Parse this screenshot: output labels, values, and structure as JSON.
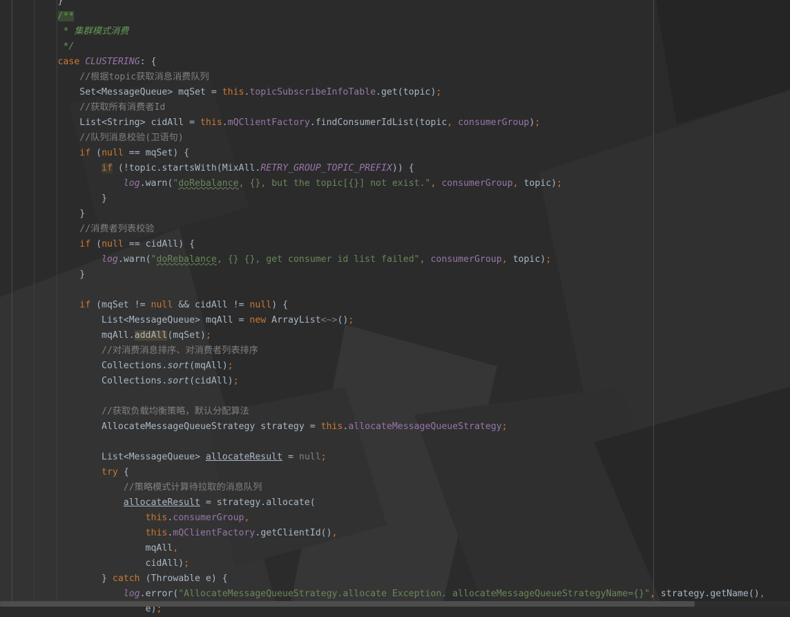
{
  "editor": {
    "lines": [
      [
        {
          "t": "        ",
          "c": "plain"
        },
        {
          "t": "}",
          "c": "plain"
        }
      ],
      [
        {
          "t": "        ",
          "c": "plain"
        },
        {
          "t": "/**",
          "c": "doc-hl"
        }
      ],
      [
        {
          "t": "         * 集群模式消费",
          "c": "doc"
        }
      ],
      [
        {
          "t": "         */",
          "c": "doc"
        }
      ],
      [
        {
          "t": "        ",
          "c": "plain"
        },
        {
          "t": "case ",
          "c": "kw"
        },
        {
          "t": "CLUSTERING",
          "c": "const"
        },
        {
          "t": ": {",
          "c": "plain"
        }
      ],
      [
        {
          "t": "            ",
          "c": "plain"
        },
        {
          "t": "//根据topic获取消息消费队列",
          "c": "comment"
        }
      ],
      [
        {
          "t": "            Set<MessageQueue> mqSet = ",
          "c": "plain"
        },
        {
          "t": "this",
          "c": "kw"
        },
        {
          "t": ".",
          "c": "plain"
        },
        {
          "t": "topicSubscribeInfoTable",
          "c": "field"
        },
        {
          "t": ".get(topic)",
          "c": "plain"
        },
        {
          "t": ";",
          "c": "punct"
        }
      ],
      [
        {
          "t": "            ",
          "c": "plain"
        },
        {
          "t": "//获取所有消费者Id",
          "c": "comment"
        }
      ],
      [
        {
          "t": "            List<String> cidAll = ",
          "c": "plain"
        },
        {
          "t": "this",
          "c": "kw"
        },
        {
          "t": ".",
          "c": "plain"
        },
        {
          "t": "mQClientFactory",
          "c": "field"
        },
        {
          "t": ".findConsumerIdList(topic",
          "c": "plain"
        },
        {
          "t": ", ",
          "c": "punct"
        },
        {
          "t": "consumerGroup",
          "c": "field"
        },
        {
          "t": ")",
          "c": "plain"
        },
        {
          "t": ";",
          "c": "punct"
        }
      ],
      [
        {
          "t": "            ",
          "c": "plain"
        },
        {
          "t": "//队列消息校验(卫语句)",
          "c": "comment"
        }
      ],
      [
        {
          "t": "            ",
          "c": "plain"
        },
        {
          "t": "if ",
          "c": "kw"
        },
        {
          "t": "(",
          "c": "plain"
        },
        {
          "t": "null ",
          "c": "kw"
        },
        {
          "t": "== mqSet) {",
          "c": "plain"
        }
      ],
      [
        {
          "t": "                ",
          "c": "plain"
        },
        {
          "t": "if",
          "c": "kw-hl"
        },
        {
          "t": " (!topic.startsWith(MixAll.",
          "c": "plain"
        },
        {
          "t": "RETRY_GROUP_TOPIC_PREFIX",
          "c": "const"
        },
        {
          "t": ")) {",
          "c": "plain"
        }
      ],
      [
        {
          "t": "                    ",
          "c": "plain"
        },
        {
          "t": "log",
          "c": "log"
        },
        {
          "t": ".warn(",
          "c": "plain"
        },
        {
          "t": "\"",
          "c": "string"
        },
        {
          "t": "doRebalance",
          "c": "string-typo"
        },
        {
          "t": ", {}, but the topic[{}] not exist.\"",
          "c": "string"
        },
        {
          "t": ", ",
          "c": "punct"
        },
        {
          "t": "consumerGroup",
          "c": "field"
        },
        {
          "t": ", ",
          "c": "punct"
        },
        {
          "t": "topic)",
          "c": "plain"
        },
        {
          "t": ";",
          "c": "punct"
        }
      ],
      [
        {
          "t": "                }",
          "c": "plain"
        }
      ],
      [
        {
          "t": "            }",
          "c": "plain"
        }
      ],
      [
        {
          "t": "            ",
          "c": "plain"
        },
        {
          "t": "//消费者列表校验",
          "c": "comment"
        }
      ],
      [
        {
          "t": "            ",
          "c": "plain"
        },
        {
          "t": "if ",
          "c": "kw"
        },
        {
          "t": "(",
          "c": "plain"
        },
        {
          "t": "null ",
          "c": "kw"
        },
        {
          "t": "== cidAll) {",
          "c": "plain"
        }
      ],
      [
        {
          "t": "                ",
          "c": "plain"
        },
        {
          "t": "log",
          "c": "log"
        },
        {
          "t": ".warn(",
          "c": "plain"
        },
        {
          "t": "\"",
          "c": "string"
        },
        {
          "t": "doRebalance",
          "c": "string-typo"
        },
        {
          "t": ", {} {}, get consumer id list failed\"",
          "c": "string"
        },
        {
          "t": ", ",
          "c": "punct"
        },
        {
          "t": "consumerGroup",
          "c": "field"
        },
        {
          "t": ", ",
          "c": "punct"
        },
        {
          "t": "topic)",
          "c": "plain"
        },
        {
          "t": ";",
          "c": "punct"
        }
      ],
      [
        {
          "t": "            }",
          "c": "plain"
        }
      ],
      [
        {
          "t": "",
          "c": "plain"
        }
      ],
      [
        {
          "t": "            ",
          "c": "plain"
        },
        {
          "t": "if ",
          "c": "kw"
        },
        {
          "t": "(mqSet != ",
          "c": "plain"
        },
        {
          "t": "null ",
          "c": "kw"
        },
        {
          "t": "&& cidAll != ",
          "c": "plain"
        },
        {
          "t": "null",
          "c": "kw"
        },
        {
          "t": ") {",
          "c": "plain"
        }
      ],
      [
        {
          "t": "                List<MessageQueue> mqAll = ",
          "c": "plain"
        },
        {
          "t": "new ",
          "c": "kw"
        },
        {
          "t": "ArrayList",
          "c": "plain"
        },
        {
          "t": "<~>",
          "c": "fold"
        },
        {
          "t": "()",
          "c": "plain"
        },
        {
          "t": ";",
          "c": "punct"
        }
      ],
      [
        {
          "t": "                mqAll.",
          "c": "plain"
        },
        {
          "t": "addAll",
          "c": "call-hl"
        },
        {
          "t": "(mqSet)",
          "c": "plain"
        },
        {
          "t": ";",
          "c": "punct"
        }
      ],
      [
        {
          "t": "                ",
          "c": "plain"
        },
        {
          "t": "//对消费消息排序、对消费者列表排序",
          "c": "comment"
        }
      ],
      [
        {
          "t": "                Collections.",
          "c": "plain"
        },
        {
          "t": "sort",
          "c": "static"
        },
        {
          "t": "(mqAll)",
          "c": "plain"
        },
        {
          "t": ";",
          "c": "punct"
        }
      ],
      [
        {
          "t": "                Collections.",
          "c": "plain"
        },
        {
          "t": "sort",
          "c": "static"
        },
        {
          "t": "(cidAll)",
          "c": "plain"
        },
        {
          "t": ";",
          "c": "punct"
        }
      ],
      [
        {
          "t": "",
          "c": "plain"
        }
      ],
      [
        {
          "t": "                ",
          "c": "plain"
        },
        {
          "t": "//获取负载均衡策略，默认分配算法",
          "c": "comment"
        }
      ],
      [
        {
          "t": "                AllocateMessageQueueStrategy strategy = ",
          "c": "plain"
        },
        {
          "t": "this",
          "c": "kw"
        },
        {
          "t": ".",
          "c": "plain"
        },
        {
          "t": "allocateMessageQueueStrategy",
          "c": "field"
        },
        {
          "t": ";",
          "c": "punct"
        }
      ],
      [
        {
          "t": "",
          "c": "plain"
        }
      ],
      [
        {
          "t": "                List<MessageQueue> ",
          "c": "plain"
        },
        {
          "t": "allocateResult",
          "c": "underline"
        },
        {
          "t": " = ",
          "c": "plain"
        },
        {
          "t": "null",
          "c": "null-gray"
        },
        {
          "t": ";",
          "c": "punct"
        }
      ],
      [
        {
          "t": "                ",
          "c": "plain"
        },
        {
          "t": "try ",
          "c": "kw"
        },
        {
          "t": "{",
          "c": "plain"
        }
      ],
      [
        {
          "t": "                    ",
          "c": "plain"
        },
        {
          "t": "//策略模式计算待拉取的消息队列",
          "c": "comment"
        }
      ],
      [
        {
          "t": "                    ",
          "c": "plain"
        },
        {
          "t": "allocateResult",
          "c": "underline"
        },
        {
          "t": " = strategy.allocate(",
          "c": "plain"
        }
      ],
      [
        {
          "t": "                        ",
          "c": "plain"
        },
        {
          "t": "this",
          "c": "kw"
        },
        {
          "t": ".",
          "c": "plain"
        },
        {
          "t": "consumerGroup",
          "c": "field"
        },
        {
          "t": ",",
          "c": "punct"
        }
      ],
      [
        {
          "t": "                        ",
          "c": "plain"
        },
        {
          "t": "this",
          "c": "kw"
        },
        {
          "t": ".",
          "c": "plain"
        },
        {
          "t": "mQClientFactory",
          "c": "field"
        },
        {
          "t": ".getClientId()",
          "c": "plain"
        },
        {
          "t": ",",
          "c": "punct"
        }
      ],
      [
        {
          "t": "                        mqAll",
          "c": "plain"
        },
        {
          "t": ",",
          "c": "punct"
        }
      ],
      [
        {
          "t": "                        cidAll)",
          "c": "plain"
        },
        {
          "t": ";",
          "c": "punct"
        }
      ],
      [
        {
          "t": "                } ",
          "c": "plain"
        },
        {
          "t": "catch ",
          "c": "kw"
        },
        {
          "t": "(Throwable e) {",
          "c": "plain"
        }
      ],
      [
        {
          "t": "                    ",
          "c": "plain"
        },
        {
          "t": "log",
          "c": "log"
        },
        {
          "t": ".error(",
          "c": "plain"
        },
        {
          "t": "\"AllocateMessageQueueStrategy.allocate Exception. allocateMessageQueueStrategyName={}\"",
          "c": "string"
        },
        {
          "t": ", ",
          "c": "punct"
        },
        {
          "t": "strategy.getName()",
          "c": "plain"
        },
        {
          "t": ",",
          "c": "punct"
        }
      ],
      [
        {
          "t": "                        ",
          "c": "plain"
        },
        {
          "t": "e)",
          "c": "plain"
        },
        {
          "t": ";",
          "c": "punct"
        }
      ]
    ]
  }
}
